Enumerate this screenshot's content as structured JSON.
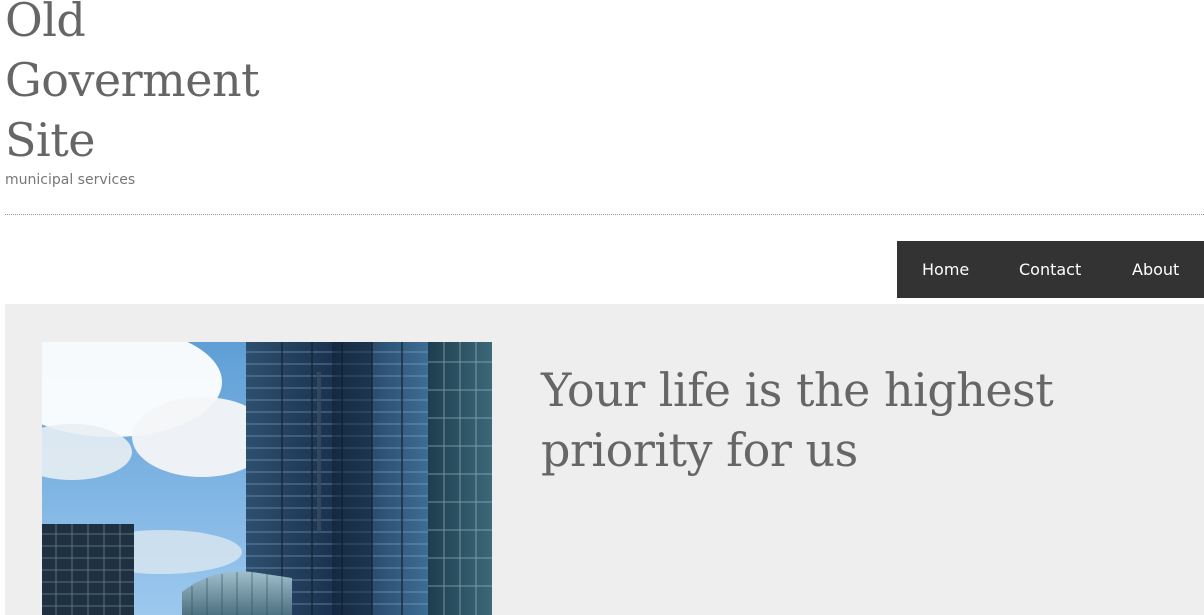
{
  "header": {
    "title_lines": [
      "Old",
      "Goverment",
      "Site"
    ],
    "tagline": "municipal services"
  },
  "nav": {
    "items": [
      {
        "label": "Home"
      },
      {
        "label": "Contact"
      },
      {
        "label": "About"
      }
    ]
  },
  "hero": {
    "heading": "Your life is the highest priority for us",
    "image": {
      "subject": "modern glass office towers against a blue sky with clouds"
    }
  },
  "colors": {
    "title_text": "#666666",
    "nav_background": "#333333",
    "nav_text": "#ffffff",
    "hero_background": "#eeeeee"
  }
}
